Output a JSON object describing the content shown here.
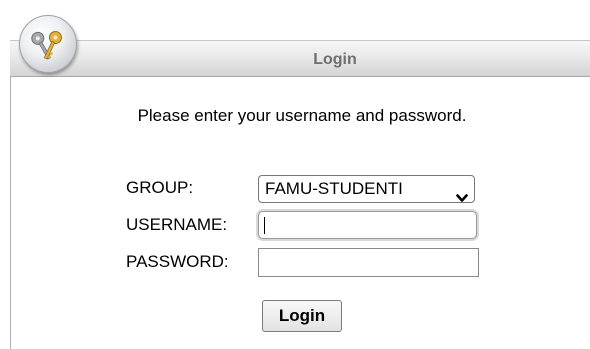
{
  "header": {
    "title": "Login",
    "badge_icon": "keys-icon"
  },
  "instructions": "Please enter your username and password.",
  "form": {
    "group_label": "GROUP:",
    "group_selected": "FAMU-STUDENTI",
    "username_label": "USERNAME:",
    "username_value": "",
    "password_label": "PASSWORD:",
    "password_value": "",
    "submit_label": "Login"
  },
  "colors": {
    "header_title": "#6e6e6e",
    "header_bg_top": "#f7f7f7",
    "header_bg_bottom": "#d4d4d4"
  }
}
